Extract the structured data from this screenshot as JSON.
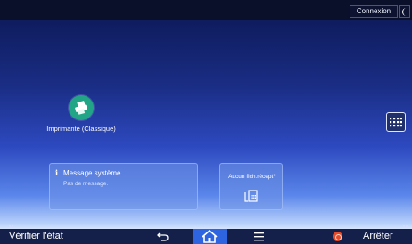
{
  "topbar": {
    "login_label": "Connexion",
    "night_mode_icon": "moon-icon"
  },
  "home": {
    "apps": [
      {
        "label": "Imprimante (Classique)",
        "icon": "printer-icon",
        "color": "#22a486"
      }
    ],
    "app_list_icon": "grid-icon"
  },
  "widgets": {
    "system_message": {
      "title": "Message système",
      "subtitle": "Pas de message.",
      "icon": "info-icon"
    },
    "fax_received": {
      "label": "Aucun fich.récept°",
      "icon": "fax-document-icon"
    }
  },
  "bottombar": {
    "status_check_label": "Vérifier l'état",
    "back_icon": "back-arrow-icon",
    "home_icon": "home-icon",
    "menu_icon": "menu-icon",
    "stop_icon": "stop-icon",
    "stop_label": "Arrêter",
    "accent_color": "#2e64e0"
  }
}
